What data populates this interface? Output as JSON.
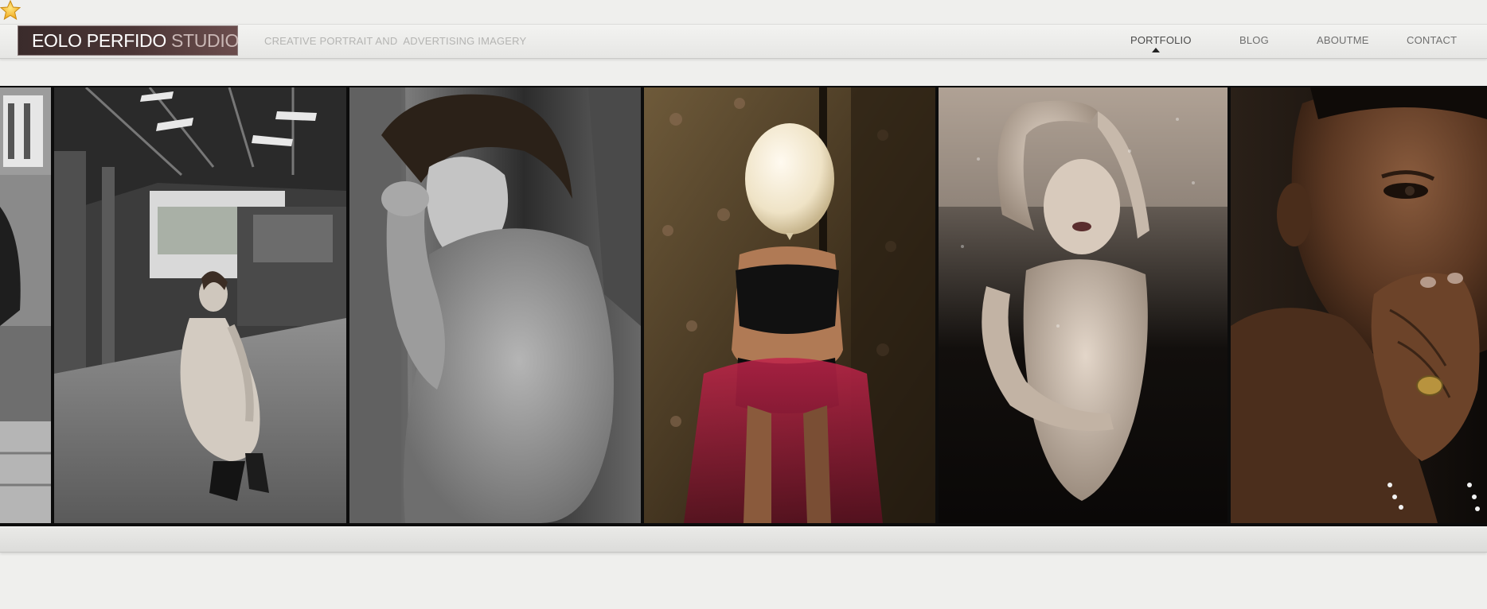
{
  "header": {
    "logo_name": "EOLO PERFIDO",
    "logo_studio": "STUDIO",
    "tagline": "CREATIVE PORTRAIT AND  ADVERTISING IMAGERY"
  },
  "nav": {
    "items": [
      {
        "label": "PORTFOLIO",
        "active": true
      },
      {
        "label": "BLOG",
        "active": false
      },
      {
        "label": "ABOUTME",
        "active": false
      },
      {
        "label": "CONTACT",
        "active": false
      }
    ]
  },
  "gallery": {
    "photos": [
      {
        "subject": "partial-architecture"
      },
      {
        "subject": "crouching-figure-warehouse"
      },
      {
        "subject": "woman-leaning-on-wall"
      },
      {
        "subject": "woman-with-balloon-head"
      },
      {
        "subject": "woman-behind-wet-glass"
      },
      {
        "subject": "man-close-up-portrait"
      }
    ]
  },
  "colors": {
    "background": "#efefed",
    "logo_bg": "#4a3535",
    "logo_studio_text": "#c9b7b5",
    "nav_text": "#6f6f6f",
    "gallery_bg": "#0c0c0c"
  },
  "icons": {
    "corner": "star-icon",
    "active_indicator": "caret-up-icon"
  }
}
